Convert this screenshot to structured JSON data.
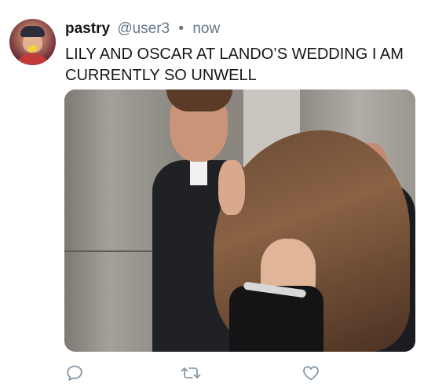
{
  "tweet": {
    "display_name": "pastry",
    "handle": "@user3",
    "separator": "•",
    "timestamp": "now",
    "text": "LILY AND OSCAR AT LANDO’S WEDDING I AM CURRENTLY SO UNWELL"
  },
  "avatar": {
    "icon": "profile-avatar"
  },
  "media": {
    "kind": "photo"
  },
  "actions": [
    {
      "name": "reply",
      "icon": "reply-icon"
    },
    {
      "name": "retweet",
      "icon": "retweet-icon"
    },
    {
      "name": "like",
      "icon": "heart-icon"
    }
  ],
  "colors": {
    "text": "#14171a",
    "muted": "#657786",
    "icon": "#8899a6"
  }
}
